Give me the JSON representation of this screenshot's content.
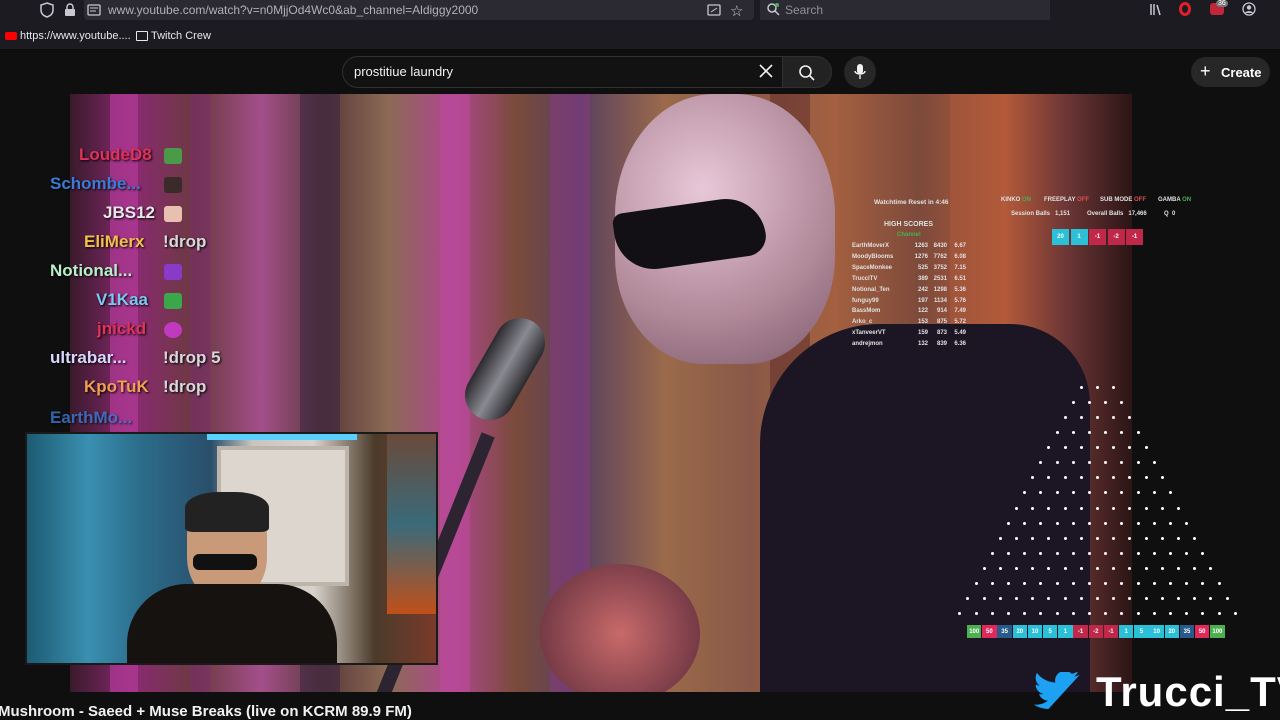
{
  "browser": {
    "url": "www.youtube.com/watch?v=n0MjjOd4Wc0&ab_channel=Aldiggy2000",
    "search_placeholder": "Search",
    "notification_count": "36",
    "bookmarks": [
      {
        "label": "https://www.youtube...."
      },
      {
        "label": "Twitch Crew"
      }
    ]
  },
  "youtube": {
    "search_value": "prostitiue laundry",
    "create_label": "Create",
    "video_title": "Mushroom - Saeed + Muse Breaks (live on KCRM 89.9 FM)"
  },
  "chat": [
    {
      "user": "LoudeD8",
      "color": "#e0325a",
      "message": ""
    },
    {
      "user": "Schombe...",
      "color": "#3a7bd5",
      "message": ""
    },
    {
      "user": "JBS12",
      "color": "#e8e8e8",
      "message": ""
    },
    {
      "user": "EliMerx",
      "color": "#f0c04a",
      "message": "!drop"
    },
    {
      "user": "Notional...",
      "color": "#b8f0c8",
      "message": ""
    },
    {
      "user": "V1Kaa",
      "color": "#7cc8f0",
      "message": ""
    },
    {
      "user": "jnickd",
      "color": "#e0325a",
      "message": ""
    },
    {
      "user": "ultrabar...",
      "color": "#d8d8ff",
      "message": "!drop 5"
    },
    {
      "user": "KpoTuK",
      "color": "#f0a050",
      "message": "!drop"
    },
    {
      "user": "EarthMo...",
      "color": "#3a7bd5",
      "message": ""
    }
  ],
  "overlay": {
    "watchtime": "Watchtime Reset in  4:46",
    "high_scores_title": "HIGH SCORES",
    "channel_label": "Channel",
    "scores": [
      {
        "name": "EarthMoverX",
        "a": "1263",
        "b": "8430",
        "c": "6.67"
      },
      {
        "name": "MoodyBlooms",
        "a": "1276",
        "b": "7762",
        "c": "6.08"
      },
      {
        "name": "SpaceMonkee",
        "a": "525",
        "b": "3752",
        "c": "7.15"
      },
      {
        "name": "TrucciTV",
        "a": "389",
        "b": "2531",
        "c": "6.51"
      },
      {
        "name": "Notional_Ten",
        "a": "242",
        "b": "1298",
        "c": "5.36"
      },
      {
        "name": "funguy99",
        "a": "197",
        "b": "1134",
        "c": "5.76"
      },
      {
        "name": "BassMom",
        "a": "122",
        "b": "914",
        "c": "7.49"
      },
      {
        "name": "Arko_c",
        "a": "153",
        "b": "875",
        "c": "5.72"
      },
      {
        "name": "xTanveerVT",
        "a": "159",
        "b": "873",
        "c": "5.49"
      },
      {
        "name": "andrejmon",
        "a": "132",
        "b": "839",
        "c": "6.36"
      }
    ],
    "toggles": [
      {
        "label": "KINKO",
        "state": "ON",
        "state_color": "#4caf50"
      },
      {
        "label": "FREEPLAY",
        "state": "OFF",
        "state_color": "#e05050"
      },
      {
        "label": "SUB MODE",
        "state": "OFF",
        "state_color": "#e05050"
      },
      {
        "label": "GAMBA",
        "state": "ON",
        "state_color": "#4caf50"
      }
    ],
    "session_balls_label": "Session Balls",
    "session_balls": "1,151",
    "overall_balls_label": "Overall Balls",
    "overall_balls": "17,466",
    "q_label": "Q",
    "q_value": "0",
    "multipliers_top": [
      {
        "v": "20",
        "color": "#2bc0d8"
      },
      {
        "v": "1",
        "color": "#2bc0d8"
      },
      {
        "v": "-1",
        "color": "#c0284a"
      },
      {
        "v": "-2",
        "color": "#c0284a"
      },
      {
        "v": "-1",
        "color": "#c0284a"
      }
    ],
    "buckets": [
      {
        "v": "100",
        "color": "#4caf50"
      },
      {
        "v": "50",
        "color": "#e0285a"
      },
      {
        "v": "35",
        "color": "#2a5a8a"
      },
      {
        "v": "20",
        "color": "#2bc0d8"
      },
      {
        "v": "10",
        "color": "#2bc0d8"
      },
      {
        "v": "5",
        "color": "#2bc0d8"
      },
      {
        "v": "1",
        "color": "#2bc0d8"
      },
      {
        "v": "-1",
        "color": "#c0284a"
      },
      {
        "v": "-2",
        "color": "#c0284a"
      },
      {
        "v": "-1",
        "color": "#c0284a"
      },
      {
        "v": "1",
        "color": "#2bc0d8"
      },
      {
        "v": "5",
        "color": "#2bc0d8"
      },
      {
        "v": "10",
        "color": "#2bc0d8"
      },
      {
        "v": "20",
        "color": "#2bc0d8"
      },
      {
        "v": "35",
        "color": "#2a5a8a"
      },
      {
        "v": "50",
        "color": "#e0285a"
      },
      {
        "v": "100",
        "color": "#4caf50"
      }
    ],
    "brand": "Trucci_TV"
  }
}
